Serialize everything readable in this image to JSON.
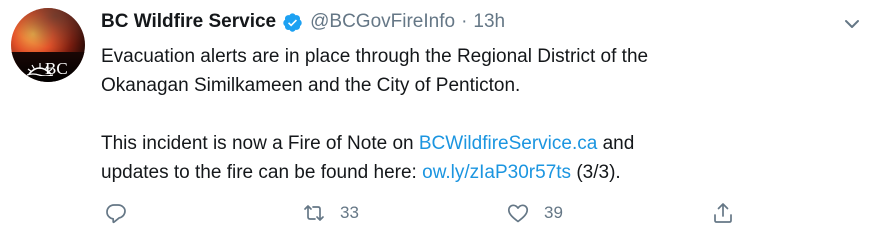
{
  "account": {
    "name": "BC Wildfire Service",
    "handle": "@BCGovFireInfo",
    "separator": "·",
    "time": "13h",
    "avatar_logo_text": "BC"
  },
  "tweet": {
    "line1": "Evacuation alerts are in place through the Regional District of the",
    "line2": "Okanagan Similkameen and the City of Penticton.",
    "line3_before": "This incident is now a Fire of Note on ",
    "line3_link": "BCWildfireService.ca",
    "line3_after": " and",
    "line4_before": "updates to the fire can be found here: ",
    "line4_link": "ow.ly/zIaP30r57ts",
    "line4_after": " (3/3)."
  },
  "actions": {
    "reply_icon": "reply-icon",
    "retweet_icon": "retweet-icon",
    "retweet_count": "33",
    "like_icon": "heart-icon",
    "like_count": "39",
    "share_icon": "share-icon",
    "menu_icon": "chevron-down-icon"
  },
  "colors": {
    "text": "#14171a",
    "muted": "#657786",
    "link": "#1b95e0",
    "verified": "#1da1f2"
  }
}
